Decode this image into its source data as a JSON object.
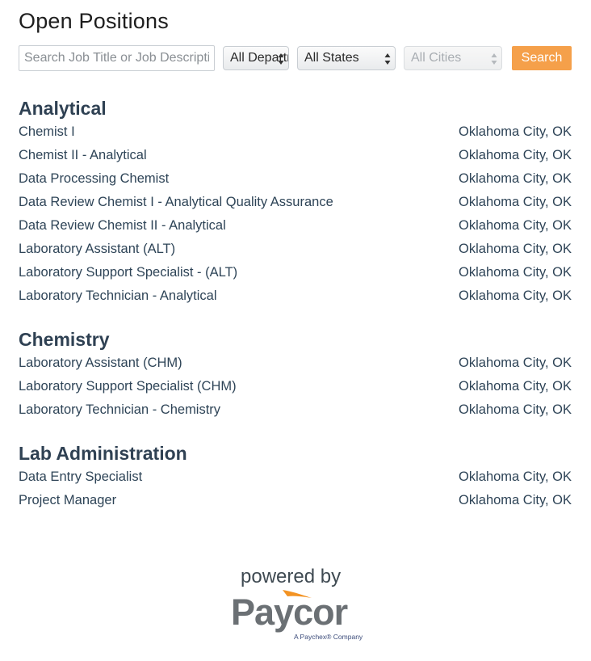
{
  "page": {
    "title": "Open Positions"
  },
  "filters": {
    "search_placeholder": "Search Job Title or Job Description",
    "department_value": "All Departments",
    "state_value": "All States",
    "city_value": "All Cities",
    "search_label": "Search"
  },
  "groups": [
    {
      "title": "Analytical",
      "jobs": [
        {
          "title": "Chemist I",
          "location": "Oklahoma City, OK"
        },
        {
          "title": "Chemist II - Analytical",
          "location": "Oklahoma City, OK"
        },
        {
          "title": "Data Processing Chemist",
          "location": "Oklahoma City, OK"
        },
        {
          "title": "Data Review Chemist I - Analytical Quality Assurance",
          "location": "Oklahoma City, OK"
        },
        {
          "title": "Data Review Chemist II - Analytical",
          "location": "Oklahoma City, OK"
        },
        {
          "title": "Laboratory Assistant (ALT)",
          "location": "Oklahoma City, OK"
        },
        {
          "title": "Laboratory Support Specialist - (ALT)",
          "location": "Oklahoma City, OK"
        },
        {
          "title": "Laboratory Technician - Analytical",
          "location": "Oklahoma City, OK"
        }
      ]
    },
    {
      "title": "Chemistry",
      "jobs": [
        {
          "title": "Laboratory Assistant (CHM)",
          "location": "Oklahoma City, OK"
        },
        {
          "title": "Laboratory Support Specialist (CHM)",
          "location": "Oklahoma City, OK"
        },
        {
          "title": "Laboratory Technician - Chemistry",
          "location": "Oklahoma City, OK"
        }
      ]
    },
    {
      "title": "Lab Administration",
      "jobs": [
        {
          "title": "Data Entry Specialist",
          "location": "Oklahoma City, OK"
        },
        {
          "title": "Project Manager",
          "location": "Oklahoma City, OK"
        }
      ]
    }
  ],
  "footer": {
    "powered_by": "powered by",
    "brand": "Paycor",
    "brand_sub": "A Paychex® Company"
  },
  "colors": {
    "accent": "#f5a04a",
    "heading": "#2f4153",
    "brand_gray": "#6b7074"
  }
}
